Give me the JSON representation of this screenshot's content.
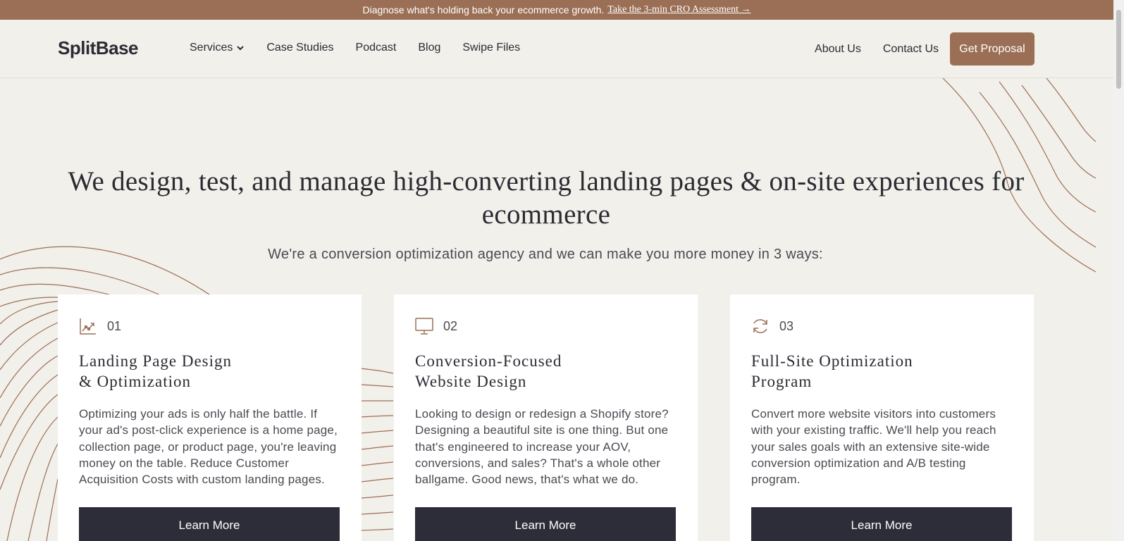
{
  "announcement": {
    "text": "Diagnose what's holding back your ecommerce growth.",
    "link": "Take the 3-min CRO Assessment →"
  },
  "nav": {
    "logo": "SplitBase",
    "links": [
      "Services",
      "Case Studies",
      "Podcast",
      "Blog",
      "Swipe Files"
    ],
    "right_links": [
      "About Us",
      "Contact Us"
    ],
    "cta": "Get Proposal"
  },
  "hero": {
    "title": "We design, test, and manage high-converting landing pages & on-site experiences for ecommerce",
    "subtitle": "We're a conversion optimization agency and we can make you more money in 3 ways:"
  },
  "cards": [
    {
      "number": "01",
      "icon": "chart-icon",
      "title_line1": "Landing Page Design",
      "title_line2": "& Optimization",
      "body": "Optimizing your ads is only half the battle. If your ad's post-click experience is a home page, collection page, or product page, you're leaving money on the table. Reduce Customer Acquisition Costs with custom landing pages.",
      "button": "Learn More"
    },
    {
      "number": "02",
      "icon": "monitor-icon",
      "title_line1": "Conversion-Focused",
      "title_line2": "Website Design",
      "body": "Looking to design or redesign a Shopify store? Designing a beautiful site is one thing. But one that's engineered to increase your AOV, conversions, and sales? That's a whole other ballgame. Good news, that's what we do.",
      "button": "Learn More"
    },
    {
      "number": "03",
      "icon": "refresh-icon",
      "title_line1": "Full-Site Optimization",
      "title_line2": "Program",
      "body": "Convert more website visitors into customers with your existing traffic. We'll help you reach your sales goals with an extensive site-wide conversion optimization and A/B testing program.",
      "button": "Learn More"
    }
  ],
  "colors": {
    "accent": "#9b6f55",
    "background": "#f2f0eb",
    "dark": "#2c2d38"
  }
}
